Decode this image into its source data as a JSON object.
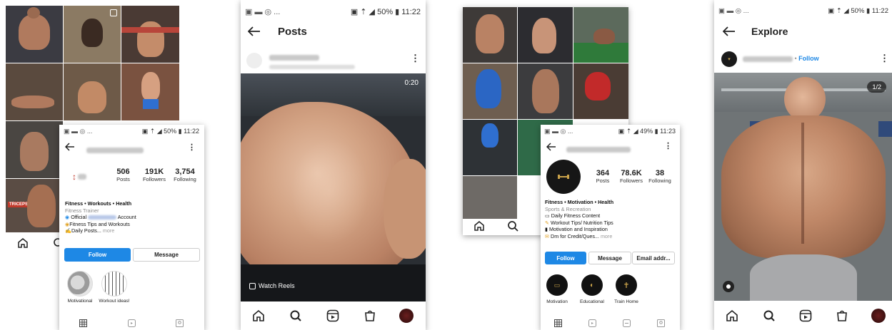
{
  "panel1": {
    "status_time": "11:22",
    "status_battery": "50%",
    "posts_count": "506",
    "posts_label": "Posts",
    "followers_count": "191K",
    "followers_label": "Followers",
    "following_count": "3,754",
    "following_label": "Following",
    "bio_title": "Fitness • Workouts • Health",
    "bio_category": "Fitness Trainer",
    "bio_line1_prefix": "Official",
    "bio_line1_suffix": "Account",
    "bio_line2": "Fitness Tips and Workouts",
    "bio_line3": "Daily Posts...",
    "bio_more": "more",
    "follow_label": "Follow",
    "message_label": "Message",
    "highlights": [
      "Motivational",
      "Workout ideas!"
    ],
    "grid_badge": "TRICEPS"
  },
  "panel2": {
    "status_time": "11:22",
    "status_battery": "50%",
    "title": "Posts",
    "video_time": "0:20",
    "watch_reels": "Watch Reels"
  },
  "panel3": {
    "status_time": "11:23",
    "status_battery": "49%",
    "posts_count": "364",
    "posts_label": "Posts",
    "followers_count": "78.6K",
    "followers_label": "Followers",
    "following_count": "38",
    "following_label": "Following",
    "bio_title": "Fitness • Motivation • Health",
    "bio_category": "Sports & Recreation",
    "bio_lines": [
      "Daily Fitness Content",
      "Workout Tips/ Nutrition Tips",
      "Motivation and Inspiration",
      "Dm for Credit/Ques..."
    ],
    "bio_more": "more",
    "follow_label": "Follow",
    "message_label": "Message",
    "email_label": "Email addr...",
    "highlights": [
      "Motivation",
      "Educational",
      "Train Home"
    ]
  },
  "panel4": {
    "status_time": "11:22",
    "status_battery": "50%",
    "title": "Explore",
    "follow_link": "Follow",
    "counter": "1/2"
  }
}
